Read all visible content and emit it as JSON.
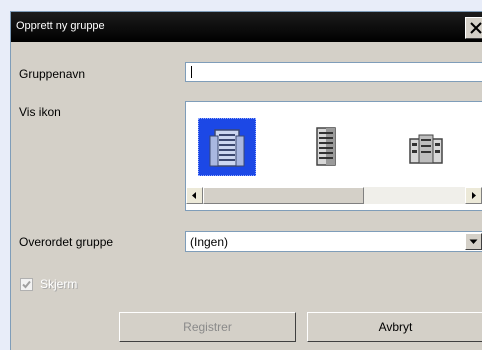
{
  "dialog": {
    "title": "Opprett ny gruppe",
    "close_glyph": "✕"
  },
  "fields": {
    "group_name_label": "Gruppenavn",
    "group_name_value": "",
    "show_icon_label": "Vis ikon",
    "parent_group_label": "Overordet gruppe",
    "parent_group_value": "(Ingen)",
    "screen_checkbox_label": "Skjerm",
    "screen_checked": true,
    "screen_enabled": false
  },
  "icons": [
    {
      "name": "building-tall-blue-icon",
      "selected": true
    },
    {
      "name": "building-tall-gray-icon",
      "selected": false
    },
    {
      "name": "building-low-gray-icon",
      "selected": false
    }
  ],
  "buttons": {
    "register_label": "Registrer",
    "register_enabled": false,
    "cancel_label": "Avbryt"
  },
  "colors": {
    "titlebar": "#000000",
    "dialog_bg": "#d4d0c8",
    "selection": "#1c48e6",
    "outside_bg": "#e8edf9"
  }
}
